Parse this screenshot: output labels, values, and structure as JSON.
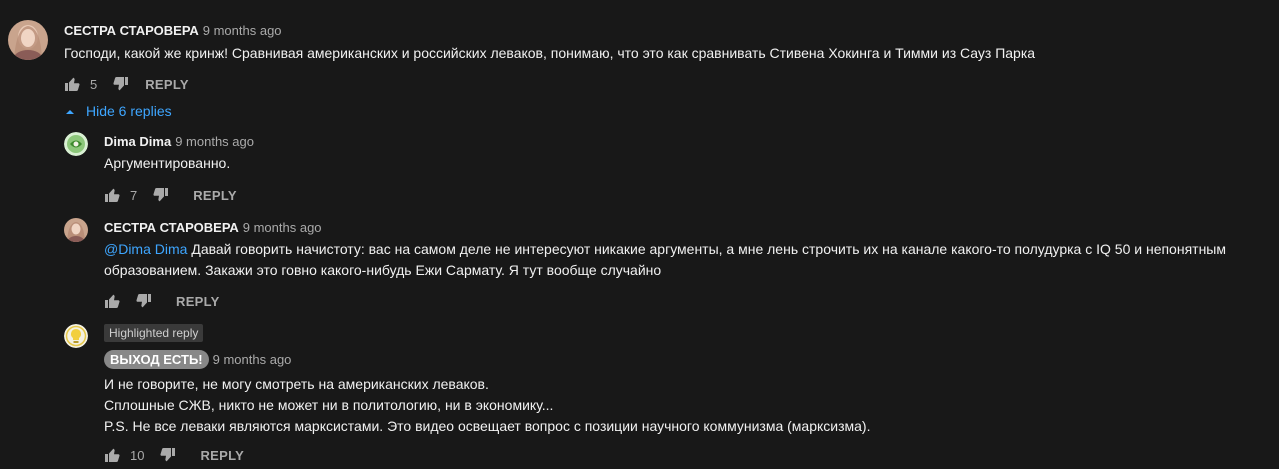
{
  "comments": [
    {
      "author": "СЕСТРА СТАРОВЕРА",
      "time": "9 months ago",
      "text": "Господи, какой же кринж! Сравнивая американских и российских леваков, понимаю, что это как сравнивать Стивена Хокинга и Тимми из Сауз Парка",
      "likes": "5",
      "reply_label": "REPLY"
    }
  ],
  "toggle": {
    "label": "Hide 6 replies"
  },
  "replies": [
    {
      "author": "Dima Dima",
      "time": "9 months ago",
      "text": "Аргументированно.",
      "likes": "7",
      "reply_label": "REPLY"
    },
    {
      "author": "СЕСТРА СТАРОВЕРА",
      "time": "9 months ago",
      "mention": "@Dima Dima",
      "text_line1": " Давай говорить начистоту: вас на самом деле не интересуют никакие аргументы, а мне лень строчить их на канале какого-то полудурка с IQ 50 и непонятным",
      "text_line2": "образованием. Закажи это говно какого-нибудь Ежи Сармату. Я тут вообще случайно",
      "likes": "",
      "reply_label": "REPLY"
    },
    {
      "highlight_label": "Highlighted reply",
      "author": "ВЫХОД ЕСТЬ!",
      "time": "9 months ago",
      "lines": [
        "И не говорите, не могу смотреть на американских леваков.",
        "Сплошные СЖВ, никто не может ни в политологию, ни в экономику...",
        "P.S. Не все леваки являются марксистами. Это видео освещает вопрос с позиции научного коммунизма (марксизма)."
      ],
      "likes": "10",
      "reply_label": "REPLY"
    }
  ],
  "colors": {
    "background": "#181818",
    "link": "#3ea6ff",
    "muted": "#aaaaaa"
  }
}
